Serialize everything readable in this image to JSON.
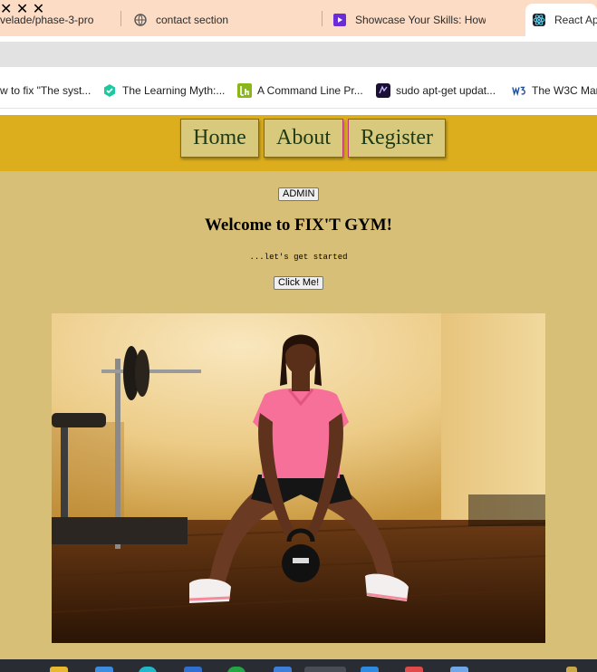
{
  "browser": {
    "tabs": [
      {
        "title": "velade/phase-3-pro",
        "icon": "github-icon"
      },
      {
        "title": "contact section",
        "icon": "globe-icon"
      },
      {
        "title": "Showcase Your Skills: How to",
        "icon": "pluralsight-icon"
      },
      {
        "title": "React Ap",
        "icon": "react-icon"
      }
    ],
    "close_glyph": "✕",
    "bookmarks": [
      {
        "label": "w to fix \"The syst...",
        "icon": "none"
      },
      {
        "label": "The Learning Myth:...",
        "icon": "hexagon-icon"
      },
      {
        "label": "A Command Line Pr...",
        "icon": "lh-icon"
      },
      {
        "label": "sudo apt-get updat...",
        "icon": "terminal-icon"
      },
      {
        "label": "The W3C Mar",
        "icon": "w3c-icon"
      }
    ]
  },
  "nav": {
    "links": [
      "Home",
      "About",
      "Register"
    ]
  },
  "page": {
    "admin_button": "ADMIN",
    "welcome": "Welcome to FIX'T GYM!",
    "tagline": "...let's get started",
    "click_button": "Click Me!"
  },
  "hero_image": {
    "subject": "woman-kettlebell-squat",
    "alt": ""
  },
  "colors": {
    "page_bg": "#d8bf78",
    "navbar_bg": "#dcae1e",
    "nav_link_bg": "#d8c97c",
    "nav_link_border": "#c0347a",
    "nav_link_text": "#1f3a15",
    "tab_strip": "#fcdcc5"
  }
}
